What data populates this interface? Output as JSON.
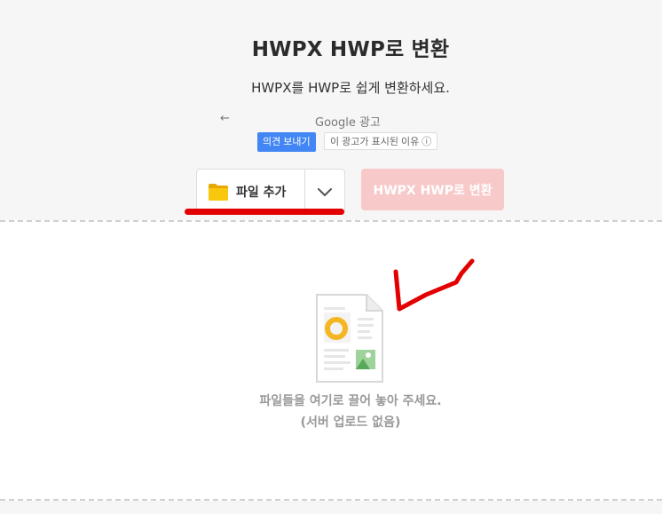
{
  "header": {
    "title": "HWPX HWP로 변환",
    "subtitle": "HWPX를 HWP로 쉽게 변환하세요."
  },
  "ad": {
    "back_glyph": "←",
    "label": "Google 광고",
    "feedback_button": "의견 보내기",
    "why_button": "이 광고가 표시된 이유 ⓘ"
  },
  "toolbar": {
    "add_files_label": "파일 추가",
    "convert_label": "HWPX HWP로 변환"
  },
  "drop_zone": {
    "hint_line1": "파일들을 여기로 끌어 놓아 주세요.",
    "hint_line2": "(서버 업로드 없음)"
  },
  "colors": {
    "accent_red": "#e30000",
    "convert_disabled": "#f7c9c9",
    "ad_blue": "#4285f4",
    "folder_yellow": "#f9c80e"
  },
  "icons": [
    "back-arrow-icon",
    "folder-icon",
    "chevron-down-icon",
    "document-icon"
  ]
}
